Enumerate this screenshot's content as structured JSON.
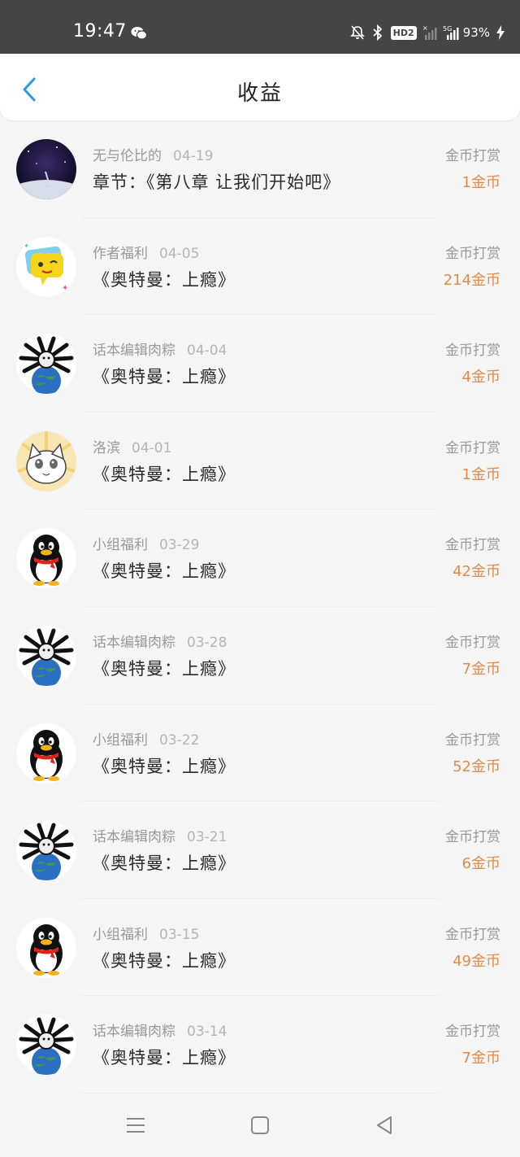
{
  "status_bar": {
    "time": "19:47",
    "battery": "93%",
    "hd_badge": "HD2",
    "icons": [
      "wechat-icon",
      "mute-bell-icon",
      "bluetooth-icon",
      "signal-icon",
      "5g-signal-icon",
      "charging-icon"
    ]
  },
  "header": {
    "title": "收益",
    "back_icon": "chevron-left-icon",
    "accent_color": "#2a9ae8"
  },
  "items": [
    {
      "avatar": "night-sky",
      "source": "无与伦比的",
      "date": "04-19",
      "title": "章节：《第八章 让我们开始吧》",
      "type": "金币打赏",
      "amount": "1金币"
    },
    {
      "avatar": "chat-bubble",
      "source": "作者福利",
      "date": "04-05",
      "title": "《奥特曼：上瘾》",
      "type": "金币打赏",
      "amount": "214金币"
    },
    {
      "avatar": "spider-earth",
      "source": "话本编辑肉粽",
      "date": "04-04",
      "title": "《奥特曼：上瘾》",
      "type": "金币打赏",
      "amount": "4金币"
    },
    {
      "avatar": "cat",
      "source": "洛滨",
      "date": "04-01",
      "title": "《奥特曼：上瘾》",
      "type": "金币打赏",
      "amount": "1金币"
    },
    {
      "avatar": "penguin",
      "source": "小组福利",
      "date": "03-29",
      "title": "《奥特曼：上瘾》",
      "type": "金币打赏",
      "amount": "42金币"
    },
    {
      "avatar": "spider-earth",
      "source": "话本编辑肉粽",
      "date": "03-28",
      "title": "《奥特曼：上瘾》",
      "type": "金币打赏",
      "amount": "7金币"
    },
    {
      "avatar": "penguin",
      "source": "小组福利",
      "date": "03-22",
      "title": "《奥特曼：上瘾》",
      "type": "金币打赏",
      "amount": "52金币"
    },
    {
      "avatar": "spider-earth",
      "source": "话本编辑肉粽",
      "date": "03-21",
      "title": "《奥特曼：上瘾》",
      "type": "金币打赏",
      "amount": "6金币"
    },
    {
      "avatar": "penguin",
      "source": "小组福利",
      "date": "03-15",
      "title": "《奥特曼：上瘾》",
      "type": "金币打赏",
      "amount": "49金币"
    },
    {
      "avatar": "spider-earth",
      "source": "话本编辑肉粽",
      "date": "03-14",
      "title": "《奥特曼：上瘾》",
      "type": "金币打赏",
      "amount": "7金币"
    }
  ],
  "colors": {
    "amount": "#e38a48",
    "status_bar": "#454545",
    "background": "#f5f5f5"
  },
  "nav": {
    "icons": [
      "menu-icon",
      "home-square-icon",
      "back-triangle-icon"
    ]
  }
}
